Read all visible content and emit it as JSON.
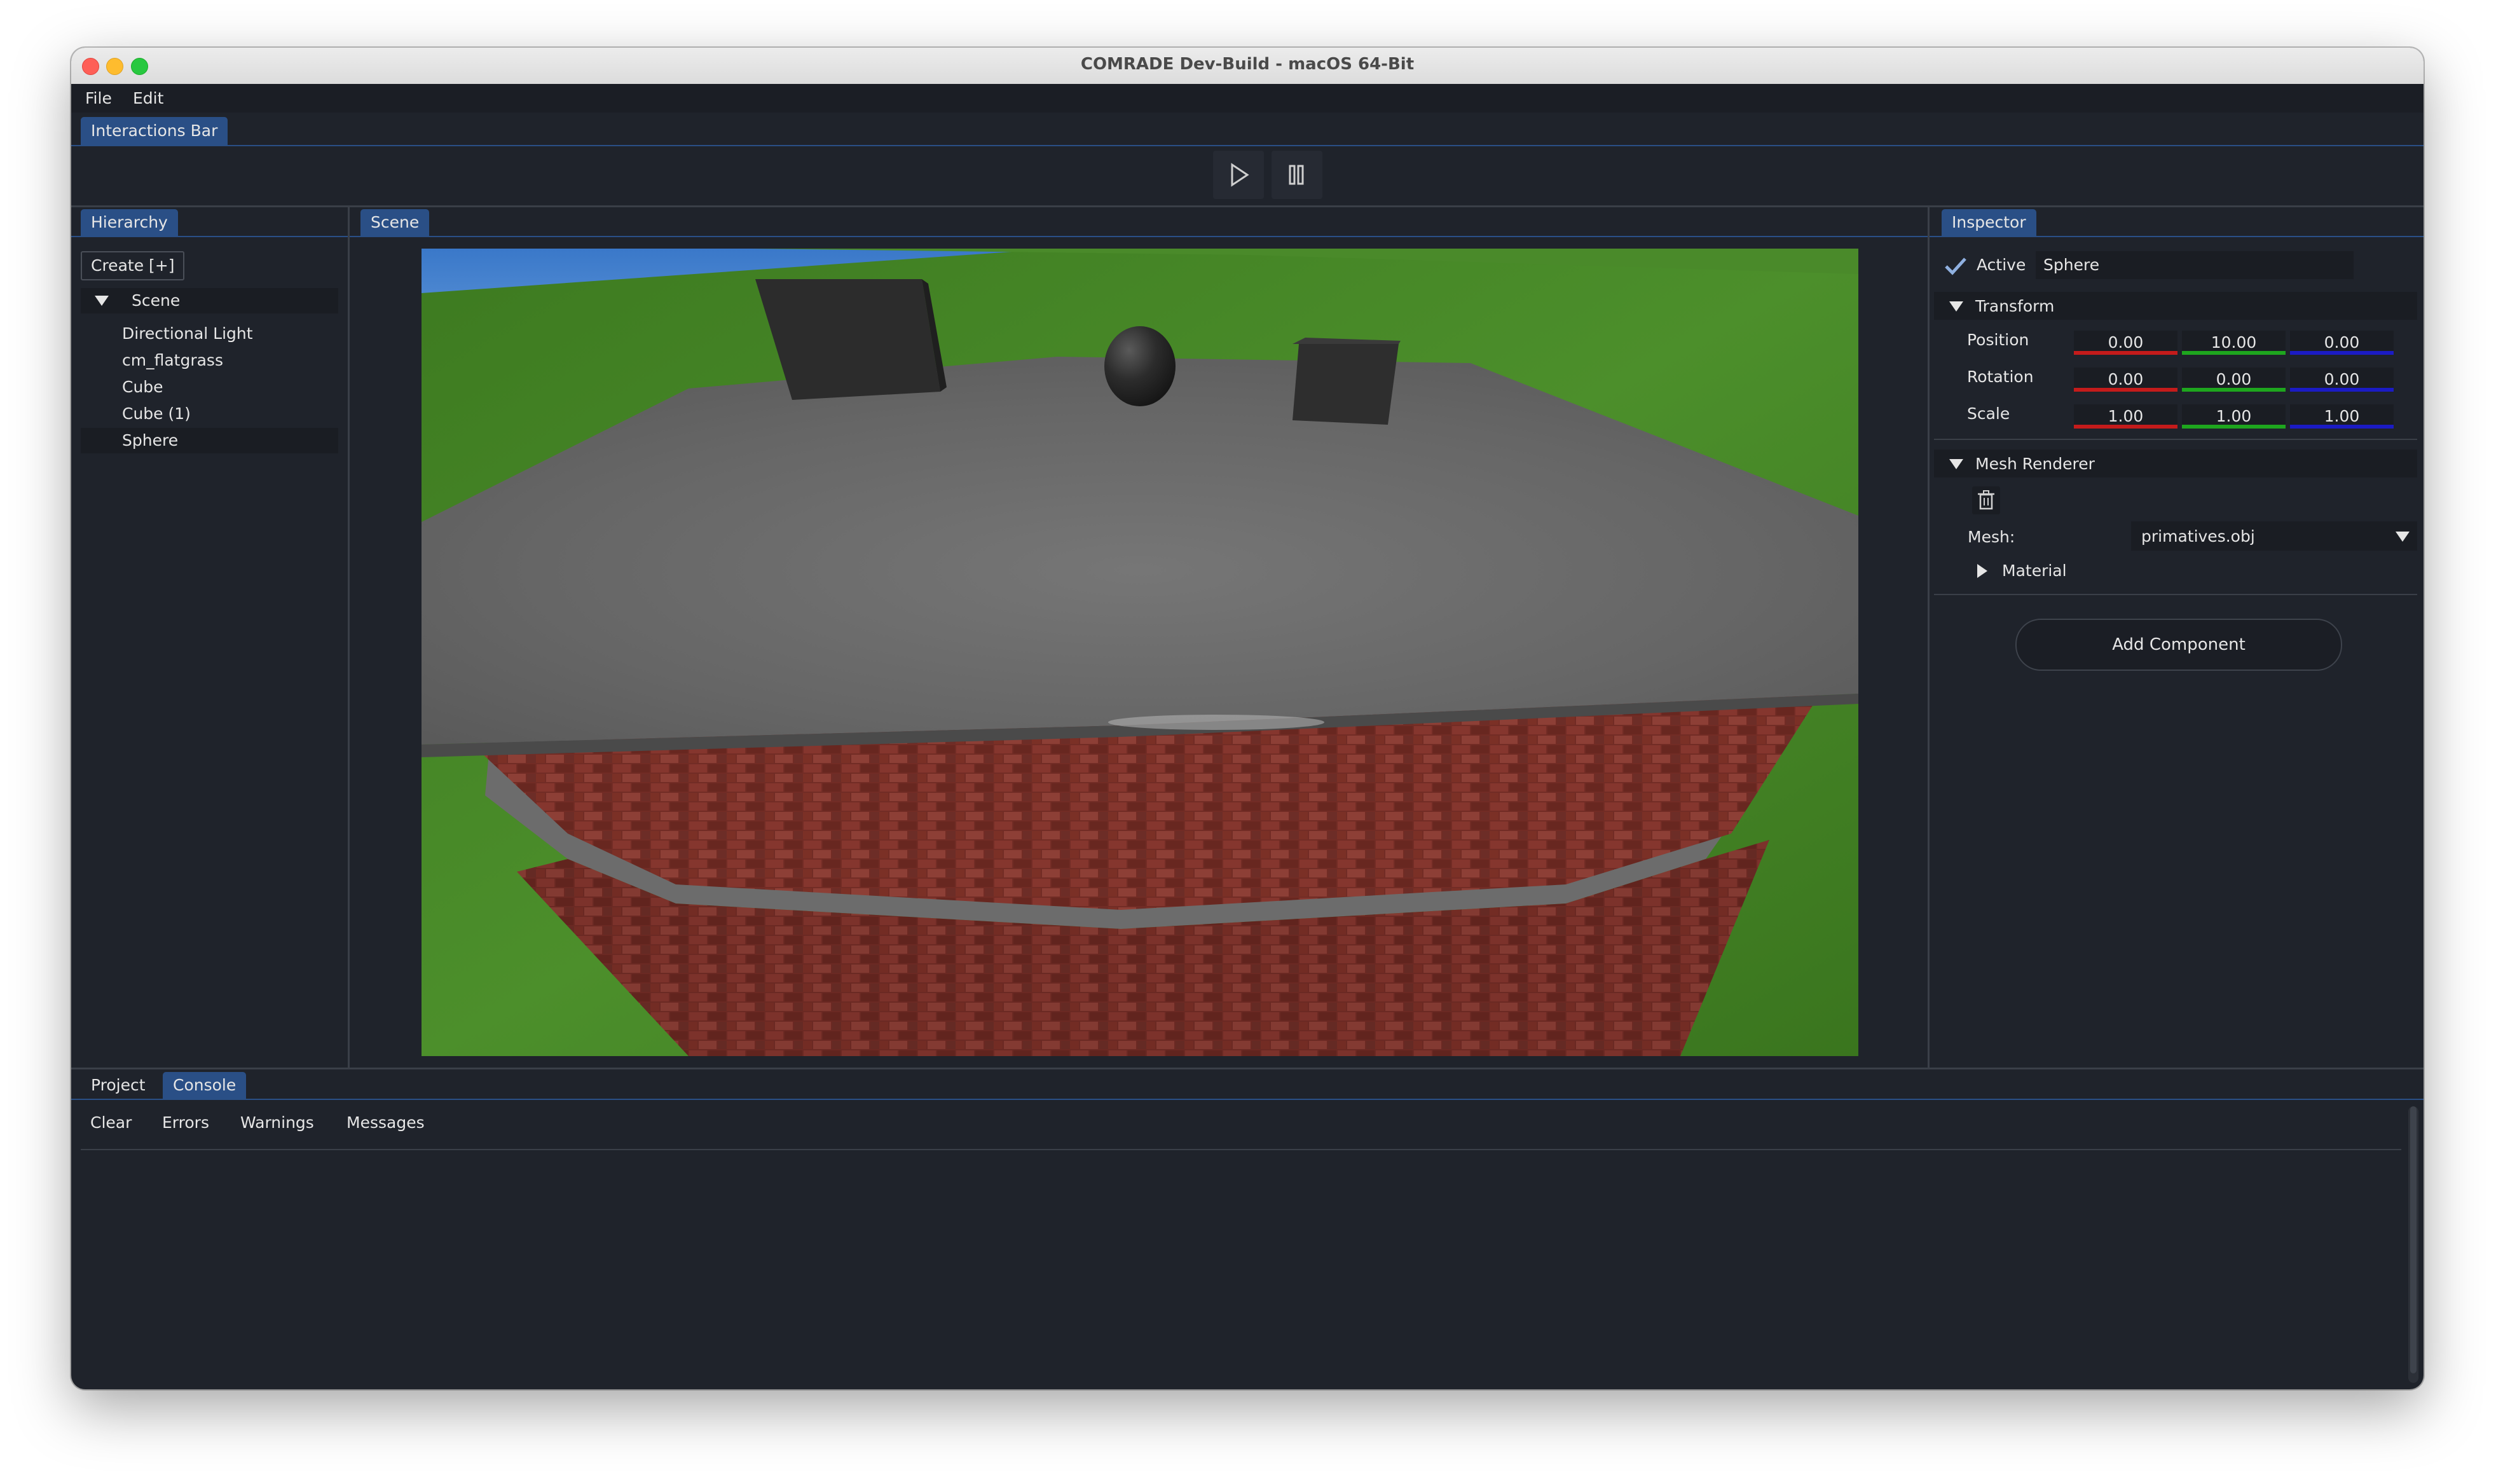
{
  "window": {
    "title": "COMRADE Dev-Build - macOS 64-Bit"
  },
  "menubar": {
    "file": "File",
    "edit": "Edit"
  },
  "interactions_bar": {
    "tab": "Interactions Bar"
  },
  "toolbar": {
    "play_icon": "play-icon",
    "pause_icon": "pause-icon"
  },
  "hierarchy": {
    "tab": "Hierarchy",
    "create_label": "Create [+]",
    "scene_label": "Scene",
    "items": [
      {
        "label": "Directional Light"
      },
      {
        "label": "cm_flatgrass"
      },
      {
        "label": "Cube"
      },
      {
        "label": "Cube (1)"
      },
      {
        "label": "Sphere"
      }
    ]
  },
  "scene": {
    "tab": "Scene"
  },
  "inspector": {
    "tab": "Inspector",
    "active_label": "Active",
    "active": true,
    "object_name": "Sphere",
    "transform": {
      "header": "Transform",
      "position_label": "Position",
      "rotation_label": "Rotation",
      "scale_label": "Scale",
      "position": {
        "x": "0.00",
        "y": "10.00",
        "z": "0.00"
      },
      "rotation": {
        "x": "0.00",
        "y": "0.00",
        "z": "0.00"
      },
      "scale": {
        "x": "1.00",
        "y": "1.00",
        "z": "1.00"
      },
      "axis_colors": {
        "x": "#c41b1b",
        "y": "#1ea61e",
        "z": "#1b1bc4"
      }
    },
    "mesh_renderer": {
      "header": "Mesh Renderer",
      "delete_icon": "trash-icon",
      "mesh_label": "Mesh:",
      "mesh_value": "primatives.obj",
      "material_label": "Material"
    },
    "add_component": "Add Component"
  },
  "bottom": {
    "tabs": [
      {
        "label": "Project"
      },
      {
        "label": "Console"
      }
    ],
    "console_buttons": {
      "clear": "Clear",
      "errors": "Errors",
      "warnings": "Warnings",
      "messages": "Messages"
    }
  },
  "colors": {
    "accent": "#2a4f86",
    "background": "#1f232b",
    "panel_dark": "#1a1d23"
  }
}
